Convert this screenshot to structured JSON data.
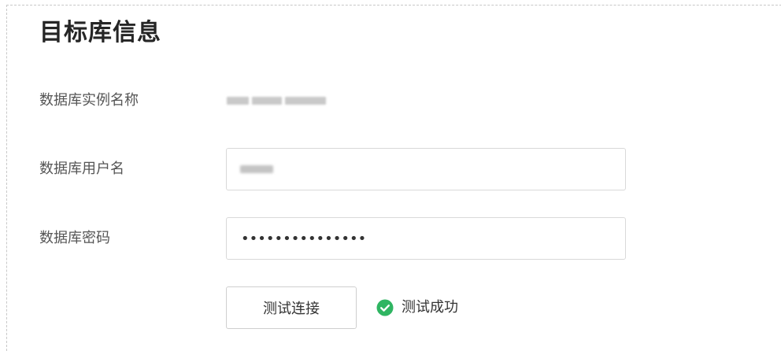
{
  "section": {
    "title": "目标库信息"
  },
  "fields": {
    "instance_name": {
      "label": "数据库实例名称"
    },
    "username": {
      "label": "数据库用户名"
    },
    "password": {
      "label": "数据库密码",
      "value": "•••••••••••••••"
    }
  },
  "actions": {
    "test_connection_label": "测试连接"
  },
  "status": {
    "text": "测试成功",
    "icon": "check-circle-icon",
    "color": "#2fb562"
  }
}
